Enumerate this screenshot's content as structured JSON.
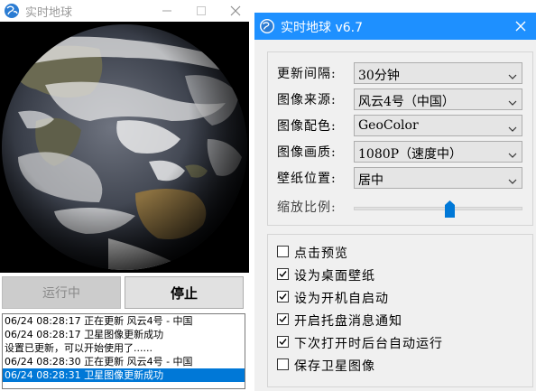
{
  "main_window": {
    "title": "实时地球",
    "run_button": "运行中",
    "stop_button": "停止",
    "log": [
      "06/24 08:28:17 正在更新 风云4号 - 中国",
      "06/24 08:28:17 卫星图像更新成功",
      "设置已更新，可以开始使用了......",
      "06/24 08:28:30 正在更新 风云4号 - 中国",
      "06/24 08:28:31 卫星图像更新成功"
    ]
  },
  "settings_window": {
    "title": "实时地球 v6.7",
    "fields": [
      {
        "label": "更新间隔:",
        "value": "30分钟"
      },
      {
        "label": "图像来源:",
        "value": "风云4号（中国）"
      },
      {
        "label": "图像配色:",
        "value": "GeoColor"
      },
      {
        "label": "图像画质:",
        "value": "1080P（速度中）"
      },
      {
        "label": "壁纸位置:",
        "value": "居中"
      }
    ],
    "zoom_label": "缩放比例:",
    "zoom_value": 0.57,
    "options": [
      {
        "label": "点击预览",
        "checked": false
      },
      {
        "label": "设为桌面壁纸",
        "checked": true
      },
      {
        "label": "设为开机自启动",
        "checked": true
      },
      {
        "label": "开启托盘消息通知",
        "checked": true
      },
      {
        "label": "下次打开时后台自动运行",
        "checked": true
      },
      {
        "label": "保存卫星图像",
        "checked": false
      }
    ]
  },
  "colors": {
    "accent": "#1e90ff",
    "selection": "#0078d7",
    "slider_thumb": "#0078d7"
  },
  "icons": {
    "app": "globe-icon",
    "minimize": "minimize-icon",
    "maximize": "maximize-icon",
    "close": "close-icon"
  }
}
